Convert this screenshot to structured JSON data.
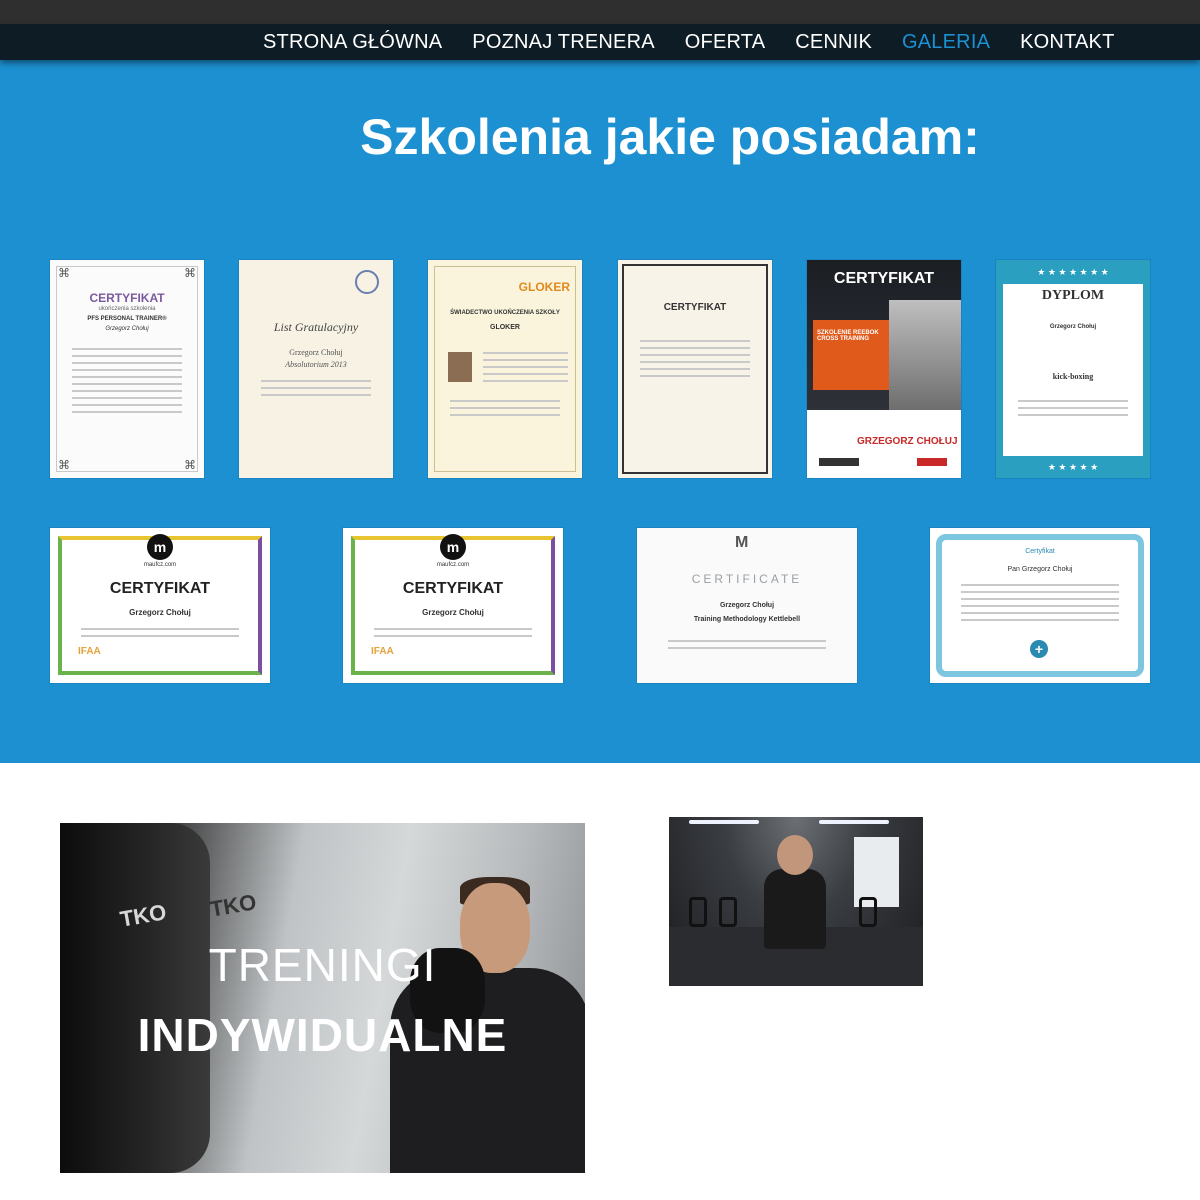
{
  "nav": {
    "items": [
      "STRONA GŁÓWNA",
      "POZNAJ TRENERA",
      "OFERTA",
      "CENNIK",
      "GALERIA",
      "KONTAKT"
    ],
    "active": "GALERIA"
  },
  "certificates_section": {
    "title": "Szkolenia jakie posiadam:",
    "row1": [
      {
        "head": "CERTYFIKAT",
        "sub": "ukończenia szkolenia",
        "detail": "PFS PERSONAL TRAINER®",
        "name": "Grzegorz Chołuj"
      },
      {
        "head": "List Gratulacyjny",
        "sub": "Absolutorium 2013",
        "name": "Grzegorz Chołuj"
      },
      {
        "head": "GLOKER",
        "sub": "ŚWIADECTWO UKOŃCZENIA SZKOŁY",
        "detail": "GLOKER"
      },
      {
        "head": "CERTYFIKAT"
      },
      {
        "head": "CERTYFIKAT",
        "sub": "SZKOLENIE REEBOK CROSS TRAINING",
        "name": "GRZEGORZ CHOŁUJ"
      },
      {
        "head": "DYPLOM",
        "sub": "Grzegorz Chołuj",
        "detail": "kick-boxing"
      }
    ],
    "row2": [
      {
        "logo": "maufcz.com",
        "head": "CERTYFIKAT",
        "name": "Grzegorz Chołuj",
        "badge": "IFAA"
      },
      {
        "logo": "maufcz.com",
        "head": "CERTYFIKAT",
        "name": "Grzegorz Chołuj",
        "badge": "IFAA"
      },
      {
        "head": "CERTIFICATE",
        "name": "Grzegorz Chołuj",
        "detail": "Training Methodology Kettlebell"
      },
      {
        "head": "Certyfikat",
        "name": "Pan Grzegorz Chołuj"
      }
    ]
  },
  "promo": {
    "line1": "TRENINGI",
    "line2": "INDYWIDUALNE",
    "bag_text_1": "TKO",
    "bag_text_2": "TKO"
  },
  "colors": {
    "blue": "#1c90d0",
    "nav_bg": "#0e1c25",
    "nav_active": "#1b90d2"
  }
}
